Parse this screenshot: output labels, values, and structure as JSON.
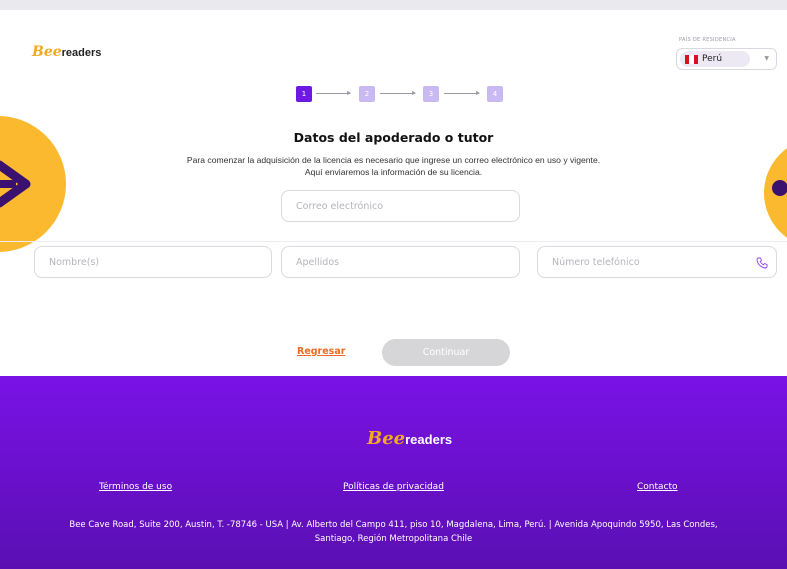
{
  "brand": {
    "logo_bee": "Bee",
    "logo_readers": "readers"
  },
  "header": {
    "country_label": "PAÍS DE RESIDENCIA",
    "country_value": "Perú",
    "flag_colors": [
      "#d91023",
      "#ffffff",
      "#d91023"
    ]
  },
  "stepper": {
    "steps": [
      "1",
      "2",
      "3",
      "4"
    ],
    "active_step": 1
  },
  "form": {
    "title": "Datos del apoderado o tutor",
    "description_line1": "Para comenzar la adquisición de la licencia es necesario que  ingrese un correo electrónico en uso y vigente.",
    "description_line2": "Aquí enviaremos la información de su licencia.",
    "email_placeholder": "Correo electrónico",
    "name_placeholder": "Nombre(s)",
    "surname_placeholder": "Apellidos",
    "phone_placeholder": "Número telefónico",
    "phone_icon": "phone-icon",
    "back_label": "Regresar",
    "continue_label": "Continuar"
  },
  "footer": {
    "logo_bee": "Bee",
    "logo_readers": "readers",
    "links": [
      "Términos de uso",
      "Políticas de privacidad",
      "Contacto"
    ],
    "address_line1": "Bee Cave Road, Suite 200, Austin, T. -78746 - USA | Av. Alberto del Campo 411, piso 10, Magdalena, Lima, Perú. | Avenida Apoquindo 5950, Las Condes,",
    "address_line2": "Santiago, Región Metropolitana Chile"
  },
  "colors": {
    "primary": "#6d18e3",
    "step_inactive": "#c9b9f2",
    "accent_orange": "#ee6a22",
    "brand_yellow": "#fbb92f",
    "footer_top": "#7a12e6",
    "footer_bottom": "#5a0fb2"
  }
}
